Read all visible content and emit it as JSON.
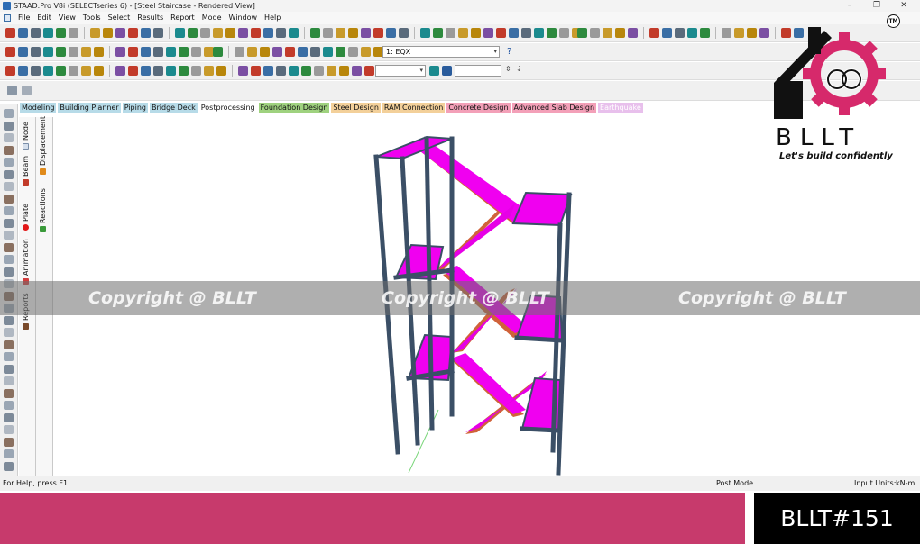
{
  "window": {
    "title": "STAAD.Pro V8i (SELECTseries 6) - [Steel Staircase - Rendered View]",
    "controls": {
      "minimize": "–",
      "restore": "❐",
      "close": "✕"
    }
  },
  "menu": {
    "items": [
      "File",
      "Edit",
      "View",
      "Tools",
      "Select",
      "Results",
      "Report",
      "Mode",
      "Window",
      "Help"
    ]
  },
  "toolbar": {
    "load_case_select": "1: EQX"
  },
  "workflow_tabs": [
    {
      "label": "Modeling",
      "color": "#b7dbe8"
    },
    {
      "label": "Building Planner",
      "color": "#b7dbe8"
    },
    {
      "label": "Piping",
      "color": "#b7dbe8"
    },
    {
      "label": "Bridge Deck",
      "color": "#b7dbe8"
    },
    {
      "label": "Postprocessing",
      "color": "#ffffff"
    },
    {
      "label": "Foundation Design",
      "color": "#9fd27f"
    },
    {
      "label": "Steel Design",
      "color": "#f3d09a"
    },
    {
      "label": "RAM Connection",
      "color": "#f3d09a"
    },
    {
      "label": "Concrete Design",
      "color": "#f3a0b8"
    },
    {
      "label": "Advanced Slab Design",
      "color": "#f3a0b8"
    },
    {
      "label": "Earthquake",
      "color": "#e8c0ec"
    }
  ],
  "side_tabs": {
    "col1": [
      "Node",
      "Beam",
      "Plate",
      "Animation",
      "Reports"
    ],
    "col2": [
      "Displacement",
      "Reactions"
    ]
  },
  "watermark": {
    "text": "Copyright @ BLLT",
    "count": 3
  },
  "logo": {
    "brand": "BLLT",
    "tagline": "Let's build confidently",
    "tm": "TM",
    "accent_color": "#d6296b"
  },
  "status": {
    "help": "For Help, press F1",
    "mode": "Post Mode",
    "units_label": "Input Units:",
    "units_value": "kN-m"
  },
  "footer": {
    "code": "BLLT#151",
    "band_color": "#c73a6c"
  },
  "colors": {
    "member": "#3b4f66",
    "plate": "#f000f0",
    "stringer": "#d0623a"
  }
}
